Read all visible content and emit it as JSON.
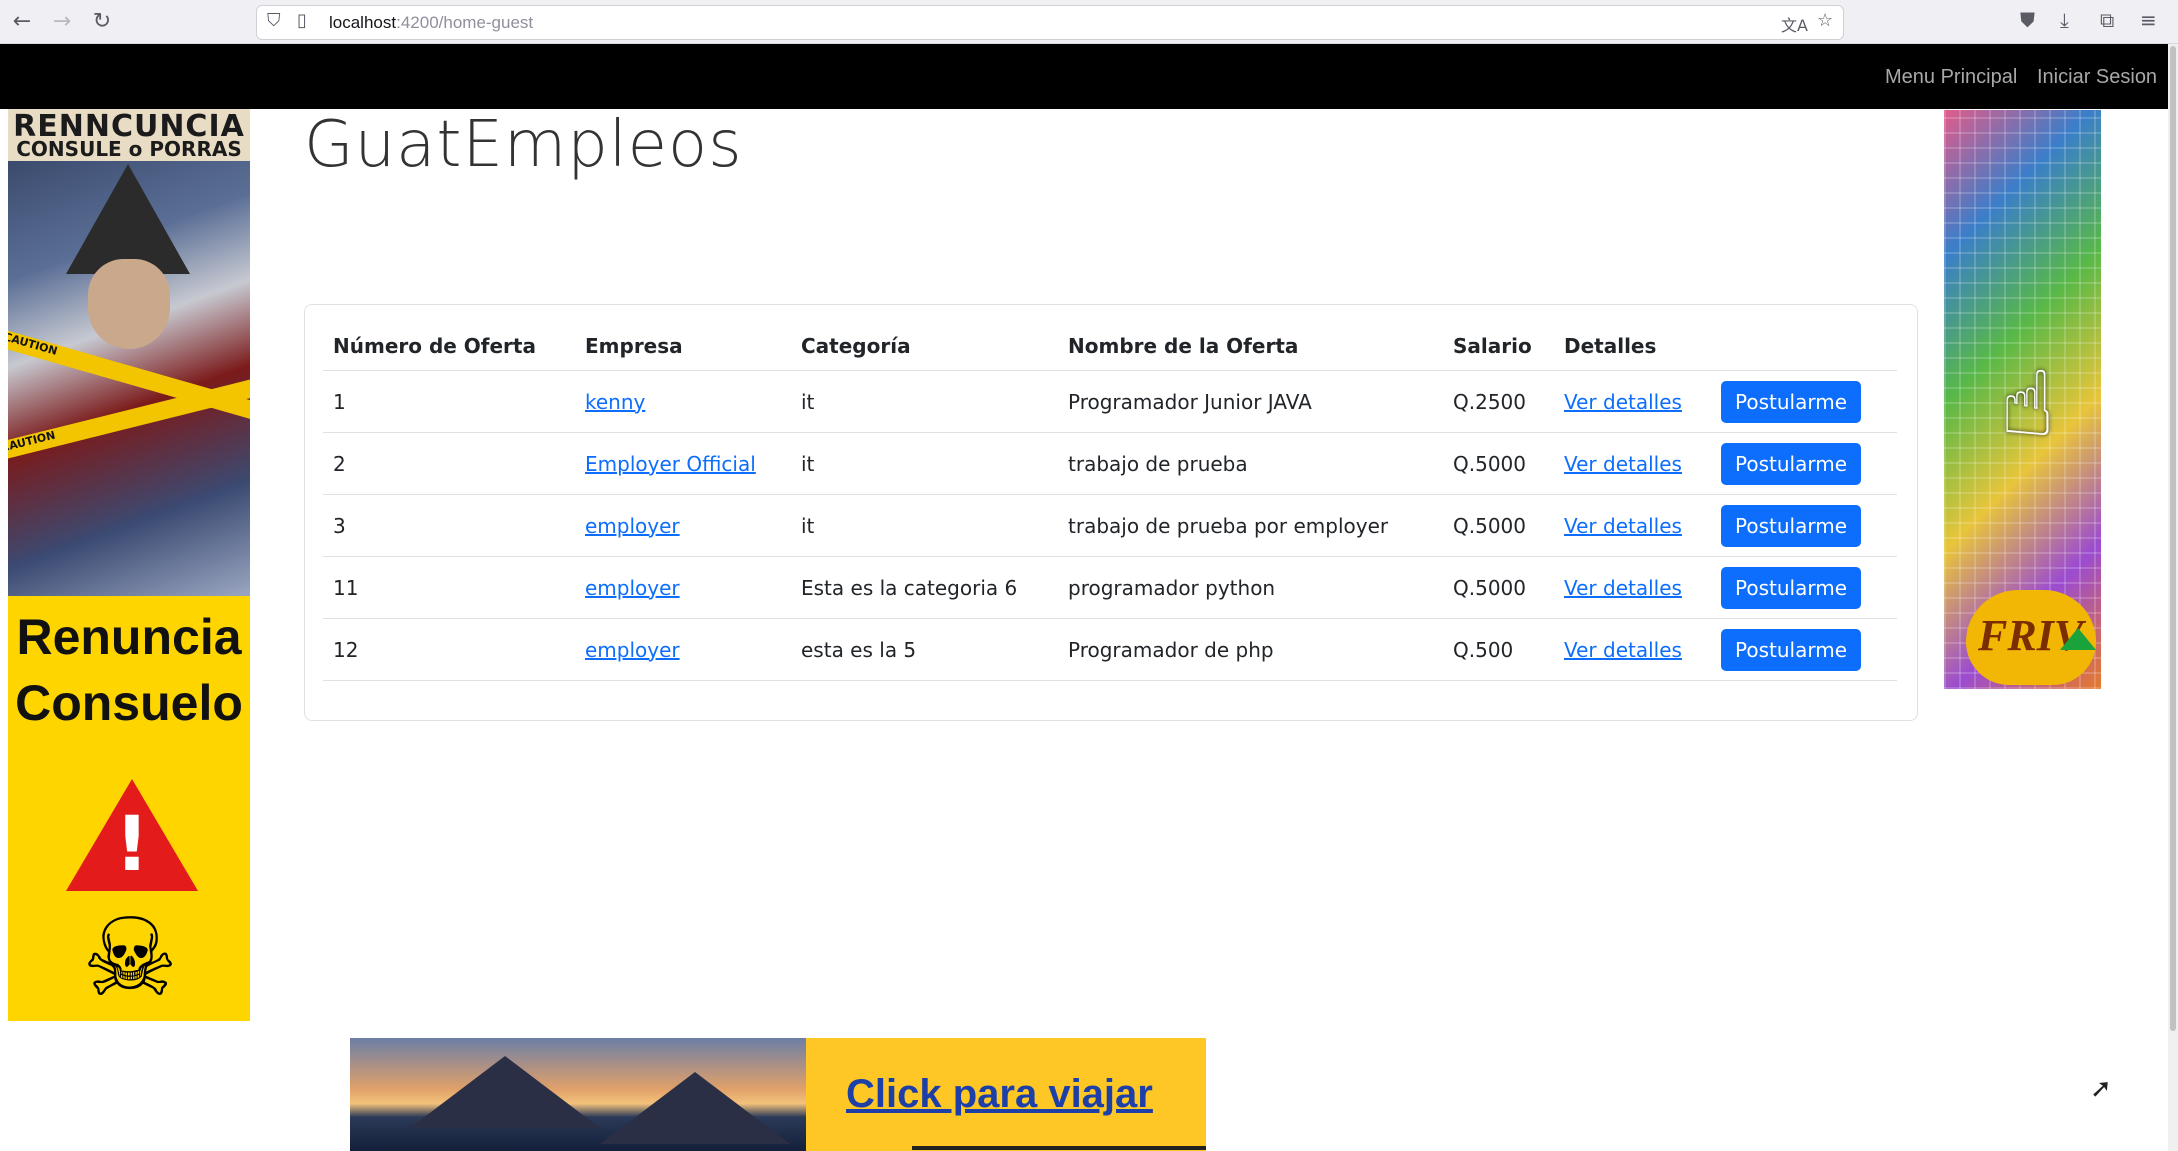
{
  "browser": {
    "url_host": "localhost",
    "url_rest": ":4200/home-guest"
  },
  "navbar": {
    "links": [
      "Menu Principal",
      "Iniciar Sesion"
    ]
  },
  "page": {
    "title": "GuatEmpleos"
  },
  "table": {
    "headers": [
      "Número de Oferta",
      "Empresa",
      "Categoría",
      "Nombre de la Oferta",
      "Salario",
      "Detalles"
    ],
    "rows": [
      {
        "numero": "1",
        "empresa": "kenny",
        "categoria": "it",
        "nombre": "Programador Junior JAVA",
        "salario": "Q.2500",
        "detalles": "Ver detalles",
        "accion": "Postularme"
      },
      {
        "numero": "2",
        "empresa": "Employer Official",
        "categoria": "it",
        "nombre": "trabajo de prueba",
        "salario": "Q.5000",
        "detalles": "Ver detalles",
        "accion": "Postularme"
      },
      {
        "numero": "3",
        "empresa": "employer",
        "categoria": "it",
        "nombre": "trabajo de prueba por employer",
        "salario": "Q.5000",
        "detalles": "Ver detalles",
        "accion": "Postularme"
      },
      {
        "numero": "11",
        "empresa": "employer",
        "categoria": "Esta es la categoria 6",
        "nombre": "programador python",
        "salario": "Q.5000",
        "detalles": "Ver detalles",
        "accion": "Postularme"
      },
      {
        "numero": "12",
        "empresa": "employer",
        "categoria": "esta es la 5",
        "nombre": "Programador de php",
        "salario": "Q.500",
        "detalles": "Ver detalles",
        "accion": "Postularme"
      }
    ]
  },
  "ads": {
    "left_top_line1": "RENNCUNCIA",
    "left_top_line2": "CONSULE o PORRAS",
    "left_tape": "CAUTION",
    "left_text_line1": "Renuncia",
    "left_text_line2": "Consuelo",
    "right_logo": "FRIV",
    "bottom_text": "Click para viajar"
  },
  "colors": {
    "primary": "#0d6efd",
    "navbar_bg": "#000000",
    "ad_yellow": "#ffd500"
  }
}
